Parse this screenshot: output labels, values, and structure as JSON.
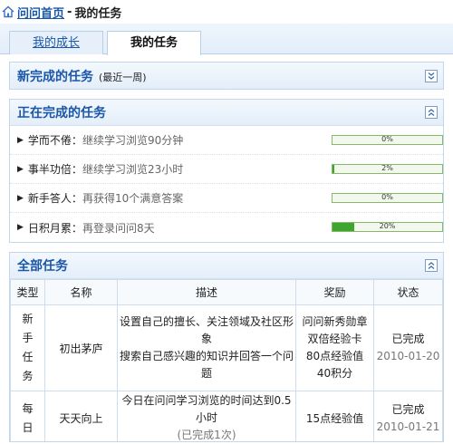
{
  "breadcrumb": {
    "home": "问问首页",
    "separator": "-",
    "current": "我的任务"
  },
  "tabs": [
    {
      "label": "我的成长",
      "active": false
    },
    {
      "label": "我的任务",
      "active": true
    }
  ],
  "completed_panel": {
    "title": "新完成的任务",
    "subtitle": "(最近一周)"
  },
  "inprogress_panel": {
    "title": "正在完成的任务",
    "tasks": [
      {
        "name": "学而不倦：",
        "desc": "继续学习浏览90分钟",
        "progress_label": "0%",
        "progress": 0
      },
      {
        "name": "事半功倍：",
        "desc": "继续学习浏览23小时",
        "progress_label": "2%",
        "progress": 0.02
      },
      {
        "name": "新手答人：",
        "desc": "再获得10个满意答案",
        "progress_label": "0%",
        "progress": 0
      },
      {
        "name": "日积月累：",
        "desc": "再登录问问8天",
        "progress_label": "20%",
        "progress": 0.2
      }
    ]
  },
  "all_panel": {
    "title": "全部任务",
    "columns": [
      "类型",
      "名称",
      "描述",
      "奖励",
      "状态"
    ],
    "rows": [
      {
        "type_chars": [
          "新",
          "手",
          "任",
          "务"
        ],
        "name": "初出茅庐",
        "desc_line1": "设置自己的擅长、关注领域及社区形象",
        "desc_line2": "搜索自己感兴趣的知识并回答一个问题",
        "reward_lines": [
          "问问新秀勋章",
          "双倍经验卡",
          "80点经验值",
          "40积分"
        ],
        "status": "已完成",
        "date": "2010-01-20"
      },
      {
        "type_chars": [
          "每",
          "日"
        ],
        "name": "天天向上",
        "desc_line1": "今日在问问学习浏览的时间达到0.5小时",
        "desc_line2": "(已完成1次)",
        "reward_lines": [
          "15点经验值"
        ],
        "status": "已完成",
        "date": "2010-01-21"
      }
    ]
  }
}
